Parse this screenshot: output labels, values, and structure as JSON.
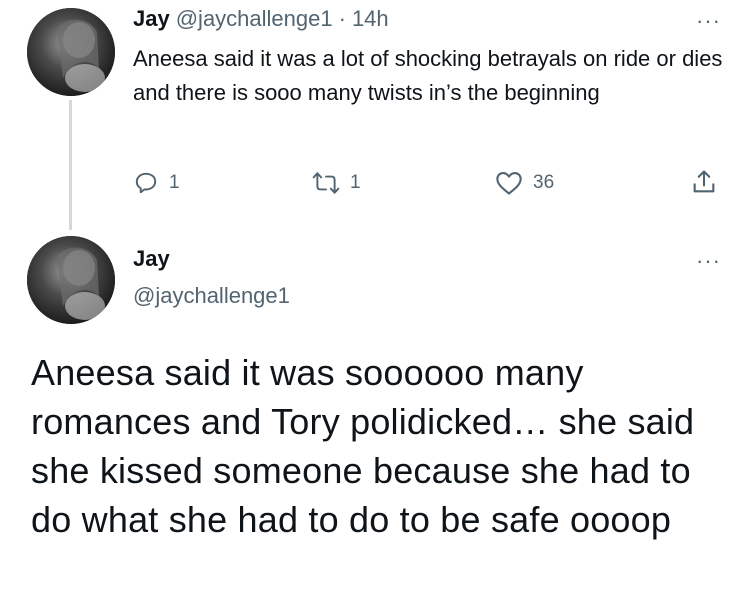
{
  "reply_tweet": {
    "author_name": "Jay",
    "author_handle": "@jaychallenge1",
    "separator": "·",
    "time": "14h",
    "text": "Aneesa said it was a lot of shocking betrayals on ride or dies and there is sooo many twists in’s the beginning",
    "replies": "1",
    "retweets": "1",
    "likes": "36",
    "more": "···"
  },
  "main_tweet": {
    "author_name": "Jay",
    "author_handle": "@jaychallenge1",
    "more": "···",
    "text": "Aneesa said it was soooooo many romances and Tory polidicked… she said she kissed someone because she had to do what she had to do to be safe oooop"
  },
  "colors": {
    "text_primary": "#0f1419",
    "text_secondary": "#536471",
    "thread_line": "#cfd9de"
  },
  "icons": {
    "reply": "reply-icon",
    "retweet": "retweet-icon",
    "like": "heart-icon",
    "share": "share-icon",
    "more": "more-icon"
  }
}
